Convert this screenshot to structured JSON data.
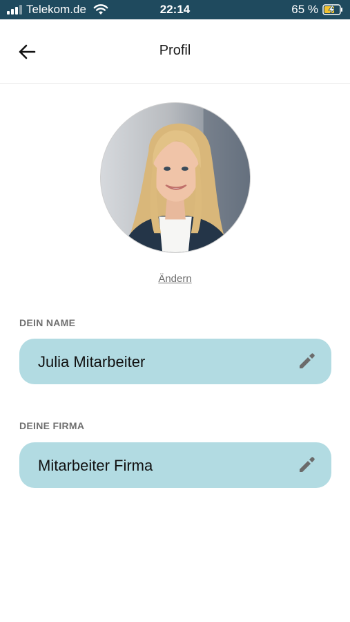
{
  "status_bar": {
    "carrier": "Telekom.de",
    "time": "22:14",
    "battery": "65 %"
  },
  "header": {
    "title": "Profil",
    "back_icon": "arrow-left-icon"
  },
  "avatar": {
    "change_label": "Ändern"
  },
  "fields": {
    "name": {
      "label": "DEIN NAME",
      "value": "Julia Mitarbeiter",
      "icon": "pencil-icon"
    },
    "company": {
      "label": "DEINE FIRMA",
      "value": "Mitarbeiter Firma",
      "icon": "pencil-icon"
    }
  },
  "colors": {
    "status_bar_bg": "#1f4a5e",
    "field_bg": "#b2dbe2",
    "label_gray": "#6f6f6f",
    "battery_charge": "#f2c230"
  }
}
